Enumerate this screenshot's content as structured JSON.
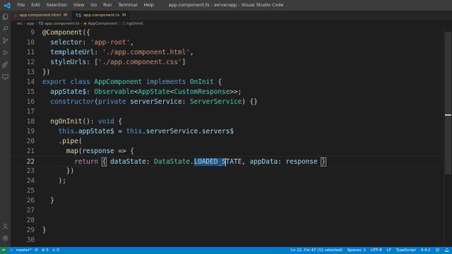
{
  "window": {
    "title": "app.component.ts - serverapp - Visual Studio Code",
    "menu": [
      "File",
      "Edit",
      "Selection",
      "View",
      "Go",
      "Run",
      "Terminal",
      "Help"
    ]
  },
  "tabs": [
    {
      "label": "app.component.html",
      "modified": "M",
      "icon": "angular-icon",
      "active": false
    },
    {
      "label": "app.component.ts",
      "modified": "M",
      "icon": "typescript-icon",
      "active": true
    }
  ],
  "breadcrumb": {
    "items": [
      "src",
      "app",
      "app.component.ts",
      "AppComponent",
      "ngOnInit"
    ]
  },
  "editor": {
    "lines": [
      {
        "n": "9"
      },
      {
        "n": "10"
      },
      {
        "n": "11"
      },
      {
        "n": "12"
      },
      {
        "n": "13"
      },
      {
        "n": "14"
      },
      {
        "n": "15"
      },
      {
        "n": "16"
      },
      {
        "n": "17"
      },
      {
        "n": "18"
      },
      {
        "n": "19"
      },
      {
        "n": "20"
      },
      {
        "n": "21"
      },
      {
        "n": "22"
      },
      {
        "n": "23"
      },
      {
        "n": "24"
      },
      {
        "n": "25"
      },
      {
        "n": "26"
      },
      {
        "n": "27"
      },
      {
        "n": "28"
      },
      {
        "n": "29"
      },
      {
        "n": "30"
      }
    ],
    "code": {
      "l9": {
        "dec": "@Component",
        "p": "({"
      },
      "l10": {
        "k": "selector",
        "c": ": ",
        "v": "'app-root'",
        "e": ","
      },
      "l11": {
        "k": "templateUrl",
        "c": ": ",
        "v": "'./app.component.html'",
        "e": ","
      },
      "l12": {
        "k": "styleUrls",
        "c": ": [",
        "v": "'./app.component.css'",
        "e": "]"
      },
      "l13": {
        "t": "})"
      },
      "l14": {
        "export": "export",
        "class": "class",
        "name": "AppComponent",
        "impl": "implements",
        "iface": "OnInit",
        "e": " {"
      },
      "l15": {
        "k": "appState$",
        "c": ": ",
        "t1": "Observable",
        "lt": "<",
        "t2": "AppState",
        "lt2": "<",
        "t3": "CustomResponse",
        "e": ">>;"
      },
      "l16": {
        "fn": "constructor",
        "p": "(",
        "priv": "private",
        "k": "serverService",
        "c": ": ",
        "t": "ServerService",
        "e": ") {}"
      },
      "l18": {
        "fn": "ngOnInit",
        "p": "(): ",
        "t": "void",
        "e": " {"
      },
      "l19": {
        "this1": "this",
        "d1": ".",
        "k1": "appState$",
        "eq": " = ",
        "this2": "this",
        "d2": ".",
        "k2": "serverService",
        "d3": ".",
        "k3": "servers$"
      },
      "l20": {
        "d": ".",
        "fn": "pipe",
        "e": "("
      },
      "l21": {
        "fn": "map",
        "p": "(",
        "k": "response",
        "e": " => {"
      },
      "l22": {
        "ret": "return",
        "ob": "{",
        "k1": "dataState",
        "c1": ": ",
        "t": "DataState",
        "d": ".",
        "sel": "LOADED_S",
        "rest": "TATE",
        "cm": ", ",
        "k2": "appData",
        "c2": ": ",
        "v": "response",
        "cb": "}"
      },
      "l23": {
        "t": "})"
      },
      "l24": {
        "t": ");"
      },
      "l26": {
        "t": "}"
      },
      "l29": {
        "t": "}"
      }
    }
  },
  "statusbar": {
    "branch": "master*",
    "sync": "⟳",
    "errors": "⊗ 0",
    "warnings": "⚠ 0",
    "position": "Ln 22, Col 47 (11 selected)",
    "spaces": "Spaces: 2",
    "encoding": "UTF-8",
    "eol": "LF",
    "language": "TypeScript",
    "version": "4.4.2"
  },
  "colors": {
    "statusbar": "#007acc",
    "titlebar": "#3c3c3c",
    "editor": "#1e1e1e",
    "selection": "#264f78"
  }
}
